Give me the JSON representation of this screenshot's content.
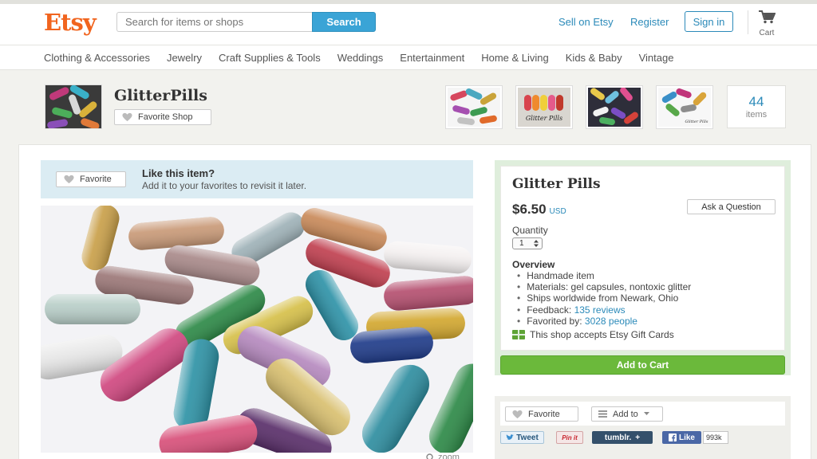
{
  "header": {
    "logo": "Etsy",
    "search_placeholder": "Search for items or shops",
    "search_button": "Search",
    "sell_link": "Sell on Etsy",
    "register_link": "Register",
    "signin_button": "Sign in",
    "cart_label": "Cart"
  },
  "categories": [
    "Clothing & Accessories",
    "Jewelry",
    "Craft Supplies & Tools",
    "Weddings",
    "Entertainment",
    "Home & Living",
    "Kids & Baby",
    "Vintage"
  ],
  "shop": {
    "name": "GlitterPills",
    "favorite_shop_button": "Favorite Shop",
    "thumb_logo_text": "Glitter Pills",
    "thumb_small_text": "Glitter Pills",
    "items_count": "44",
    "items_label": "items"
  },
  "like_bar": {
    "favorite_button": "Favorite",
    "title": "Like this item?",
    "subtitle": "Add it to your favorites to revisit it later."
  },
  "zoom_label": "zoom",
  "listing": {
    "title": "Glitter Pills",
    "price": "$6.50",
    "currency": "USD",
    "ask_button": "Ask a Question",
    "quantity_label": "Quantity",
    "quantity_value": "1",
    "overview_title": "Overview",
    "overview_items": [
      {
        "text": "Handmade item",
        "link": ""
      },
      {
        "text": "Materials: gel capsules, nontoxic glitter",
        "link": ""
      },
      {
        "text": "Ships worldwide from Newark, Ohio",
        "link": ""
      },
      {
        "text": "Feedback: ",
        "link": "135 reviews"
      },
      {
        "text": "Favorited by: ",
        "link": "3028 people"
      }
    ],
    "gift_cards_text": "This shop accepts Etsy Gift Cards",
    "add_to_cart_button": "Add to Cart"
  },
  "share": {
    "favorite_button": "Favorite",
    "add_to_button": "Add to",
    "tweet": "Tweet",
    "pinit": "Pin it",
    "tumblr": "tumblr.",
    "tumblr_plus": "+",
    "fb_like": "Like",
    "fb_count": "993k"
  },
  "colors": {
    "brand": "#f1641e",
    "link": "#2b8ab9",
    "add_to_cart": "#6bb93b"
  }
}
